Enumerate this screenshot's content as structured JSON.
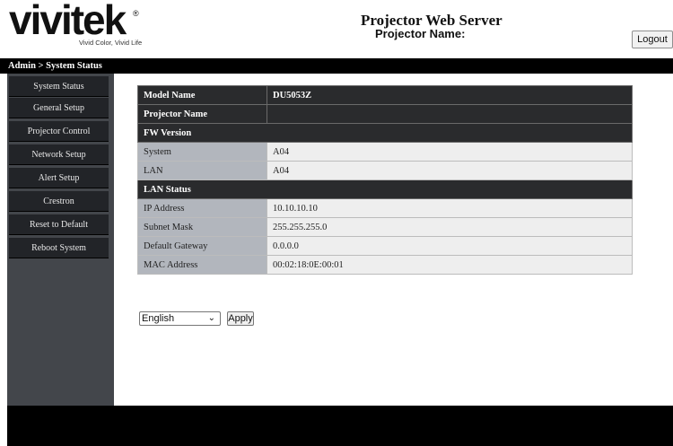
{
  "header": {
    "logo_word": "vivitek",
    "logo_reg": "®",
    "logo_tagline": "Vivid Color, Vivid Life",
    "title": "Projector Web Server",
    "projector_name_label": "Projector Name:",
    "logout_label": "Logout"
  },
  "breadcrumb": "Admin > System Status",
  "sidebar": {
    "items": [
      {
        "label": "System Status"
      },
      {
        "label": "General Setup"
      },
      {
        "label": "Projector Control"
      },
      {
        "label": "Network Setup"
      },
      {
        "label": "Alert Setup"
      },
      {
        "label": "Crestron"
      },
      {
        "label": "Reset to Default"
      },
      {
        "label": "Reboot System"
      }
    ]
  },
  "info": {
    "model_name_label": "Model Name",
    "model_name_value": "DU5053Z",
    "projector_name_label": "Projector Name",
    "projector_name_value": "",
    "fw_version_heading": "FW Version",
    "system_label": "System",
    "system_value": "A04",
    "lan_label": "LAN",
    "lan_value": "A04",
    "lan_status_heading": "LAN Status",
    "ip_label": "IP Address",
    "ip_value": "10.10.10.10",
    "subnet_label": "Subnet Mask",
    "subnet_value": "255.255.255.0",
    "gateway_label": "Default Gateway",
    "gateway_value": "0.0.0.0",
    "mac_label": "MAC Address",
    "mac_value": "00:02:18:0E:00:01"
  },
  "language": {
    "selected": "English",
    "chevron_icon": "chevron-down-icon",
    "apply_label": "Apply"
  }
}
